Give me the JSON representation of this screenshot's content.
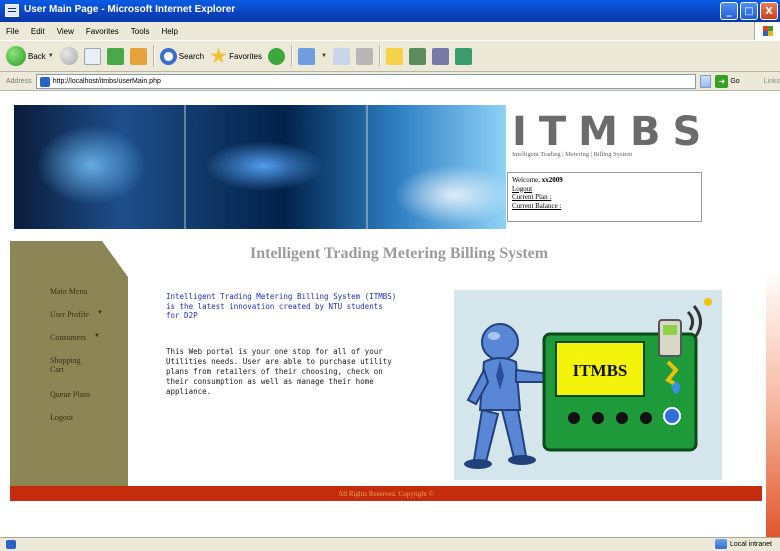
{
  "window": {
    "title": "User Main Page - Microsoft Internet Explorer",
    "controls": [
      "_",
      "□",
      "X"
    ]
  },
  "menu": [
    "File",
    "Edit",
    "View",
    "Favorites",
    "Tools",
    "Help"
  ],
  "toolbar": {
    "back_label": "Back",
    "search_label": "Search",
    "favorites_label": "Favorites"
  },
  "address": {
    "label": "Address",
    "url": "http://localhost/itmbs/userMain.php",
    "go_label": "Go",
    "links_label": "Links"
  },
  "site": {
    "logo": "ITMBS",
    "logo_subtitle": "Intelligent Trading | Metering | Billing System",
    "welcome_prefix": "Welcome, ",
    "username": "xx2009",
    "user_links": [
      "Logout",
      "Current Plan :",
      "Current Balance :"
    ],
    "page_title": "Intelligent Trading Metering Billing System",
    "intro_text": "Intelligent Trading Metering Billing System (ITMBS) is the latest innovation created by NTU students for D2P",
    "description_text": "This Web portal is your one stop for all of your Utilities needs. User are able to purchase utility plans from retailers of their choosing, check on their consumption as well as manage their home appliance.",
    "illustration_label": "ITMBS",
    "footer_text": "All Rights Reserved. Copyright ©"
  },
  "sidebar": {
    "items": [
      {
        "label": "Main Menu",
        "has_submenu": false
      },
      {
        "label": "User Profile",
        "has_submenu": true
      },
      {
        "label": "Consumers",
        "has_submenu": true
      },
      {
        "label": "Shopping Cart",
        "has_submenu": false
      },
      {
        "label": "Queue Plans",
        "has_submenu": false
      },
      {
        "label": "Logout",
        "has_submenu": false
      }
    ]
  },
  "status": {
    "zone": "Local intranet"
  },
  "colors": {
    "sidebar": "#8c8556",
    "footer": "#c42c0d",
    "intro_text": "#1f2fb8",
    "title_bar": "#0a5ce5"
  }
}
